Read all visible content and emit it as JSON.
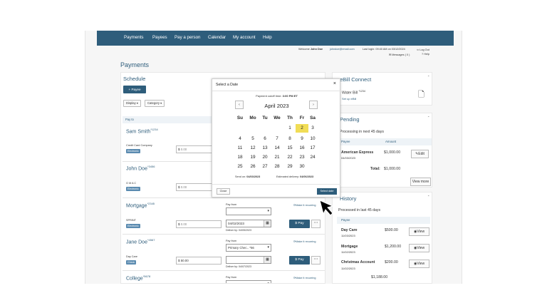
{
  "nav": {
    "items": [
      "Payments",
      "Payees",
      "Pay a person",
      "Calendar",
      "My account",
      "Help"
    ]
  },
  "userbar": {
    "welcome": "Welcome",
    "user": "John Doe",
    "email": "johndoe@email.com",
    "last_login": "Last login: 09:40 AM on 03/12/2024",
    "logout": "Log Out",
    "messages": "Messages ( 0 )",
    "help": "Help"
  },
  "page": {
    "title": "Payments"
  },
  "schedule": {
    "title": "Schedule",
    "add_payee": "Payee",
    "display": "Display",
    "category": "Category",
    "pay_to": "Pay to",
    "payees": [
      {
        "name": "Sam Smith",
        "acct": "*1234",
        "category": "Credit Card Company",
        "badge": "Electronic",
        "amount": "0.00"
      },
      {
        "name": "John Doe",
        "acct": "*3456",
        "category": "G M A C",
        "badge": "Electronic",
        "amount": "0.00"
      },
      {
        "name": "Mortgage",
        "acct": "*2345",
        "category": "SPRINT",
        "badge": "Electronic",
        "amount": "0.00",
        "pay_from": "Pay from",
        "date": "04/02/2023",
        "deliver": "Deliver by: 04/05/2023",
        "recurring": "Make it recurring",
        "pay": "Pay"
      },
      {
        "name": "Jane Doe",
        "acct": "*4567",
        "category": "Day Care",
        "badge": "Check",
        "amount": "50.00",
        "pay_from": "Pay from",
        "account": "Primary Chec.. *56",
        "deliver": "Deliver by: 04/07/2023",
        "recurring": "Make it recurring",
        "pay": "Pay"
      },
      {
        "name": "College",
        "acct": "*5678",
        "pay_from": "Pay from",
        "recurring": "Make it recurring"
      }
    ],
    "currency": "$"
  },
  "ebill": {
    "title": "eBill Connect",
    "water": "Water Bill",
    "water_acct": "*1234",
    "setup": "Set up eBill"
  },
  "pending": {
    "title": "Pending",
    "processing": "Processing in next 45 days",
    "col_payee": "Payee",
    "col_amount": "Amount",
    "payee": "American Express",
    "date": "04/03/2023",
    "amount": "$1,000.00",
    "edit": "Edit",
    "total_label": "Total:",
    "total": "$1,000.00",
    "view_more": "View more"
  },
  "history": {
    "title": "History",
    "processed": "Processed in last 45 days",
    "col_payee": "Payee",
    "rows": [
      {
        "payee": "Day Care",
        "date": "11/03/2023",
        "amount": "$500.00",
        "view": "View"
      },
      {
        "payee": "Mortgage",
        "date": "11/02/2023",
        "amount": "$1,200.00",
        "view": "View"
      },
      {
        "payee": "Christmas Account",
        "date": "11/02/2023",
        "amount": "$200.00",
        "view": "View"
      }
    ],
    "total": "$1,188.00"
  },
  "datepicker": {
    "title": "Select a Date",
    "close_x": "×",
    "cutoff": "Payment cutoff time:",
    "cutoff_time": "3:00 PM ET",
    "prev": "‹",
    "next": "›",
    "month": "April 2023",
    "dow": [
      "Su",
      "Mo",
      "Tu",
      "We",
      "Th",
      "Fr",
      "Sa"
    ],
    "weeks": [
      [
        "",
        "",
        "",
        "",
        "1",
        "2",
        "3"
      ],
      [
        "4",
        "5",
        "6",
        "7",
        "8",
        "9",
        "10"
      ],
      [
        "11",
        "12",
        "13",
        "14",
        "15",
        "16",
        "17"
      ],
      [
        "18",
        "19",
        "20",
        "21",
        "22",
        "23",
        "24"
      ],
      [
        "25",
        "26",
        "27",
        "28",
        "29",
        "30",
        ""
      ]
    ],
    "selected": "2",
    "send_on_label": "Send on:",
    "send_on": "04/03/2023",
    "est_label": "Estimated delivery:",
    "est": "04/06/2023",
    "close": "Close",
    "select": "Select date"
  },
  "colors": {
    "brand": "#2e5d7b",
    "selected_day": "#f1dd56"
  }
}
